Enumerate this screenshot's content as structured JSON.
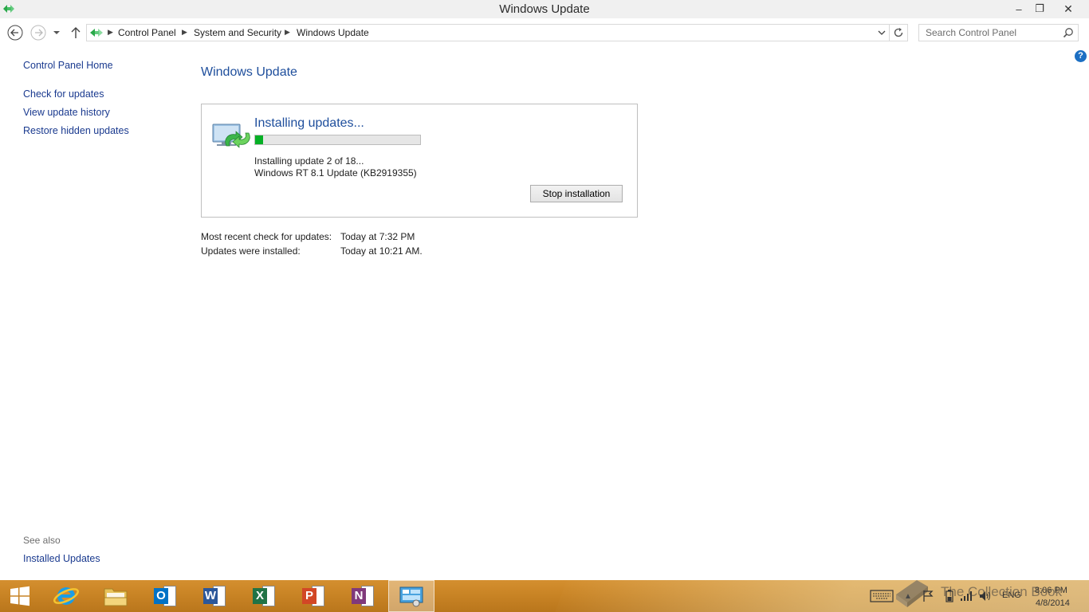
{
  "window": {
    "title": "Windows Update",
    "minimize": "–",
    "restore": "❐",
    "close": "✕"
  },
  "address": {
    "breadcrumbs": [
      "Control Panel",
      "System and Security",
      "Windows Update"
    ],
    "search_placeholder": "Search Control Panel"
  },
  "help": {
    "label": "?"
  },
  "sidebar": {
    "home": "Control Panel Home",
    "links": [
      "Check for updates",
      "View update history",
      "Restore hidden updates"
    ],
    "see_also_heading": "See also",
    "see_also_links": [
      "Installed Updates"
    ]
  },
  "main": {
    "title": "Windows Update",
    "status": {
      "heading": "Installing updates...",
      "progress_fraction": 0.05,
      "progress_color": "#06b025",
      "line1": "Installing update 2 of 18...",
      "line2": "Windows RT 8.1 Update (KB2919355)",
      "stop_button": "Stop installation"
    },
    "info": [
      {
        "label": "Most recent check for updates:",
        "value": "Today at 7:32 PM"
      },
      {
        "label": "Updates were installed:",
        "value": "Today at 10:21 AM."
      }
    ]
  },
  "taskbar": {
    "apps": [
      "start",
      "internet-explorer",
      "file-explorer",
      "outlook",
      "word",
      "excel",
      "powerpoint",
      "onenote",
      "control-panel"
    ],
    "app_letters": {
      "outlook": "O",
      "word": "W",
      "excel": "X",
      "powerpoint": "P",
      "onenote": "N"
    },
    "app_colors": {
      "outlook": "#0072c6",
      "word": "#2b579a",
      "excel": "#217346",
      "powerpoint": "#d24726",
      "onenote": "#80397b"
    },
    "language": "ENG",
    "time": "8:06 PM",
    "date": "4/8/2014",
    "watermark": "The Collection Book"
  }
}
